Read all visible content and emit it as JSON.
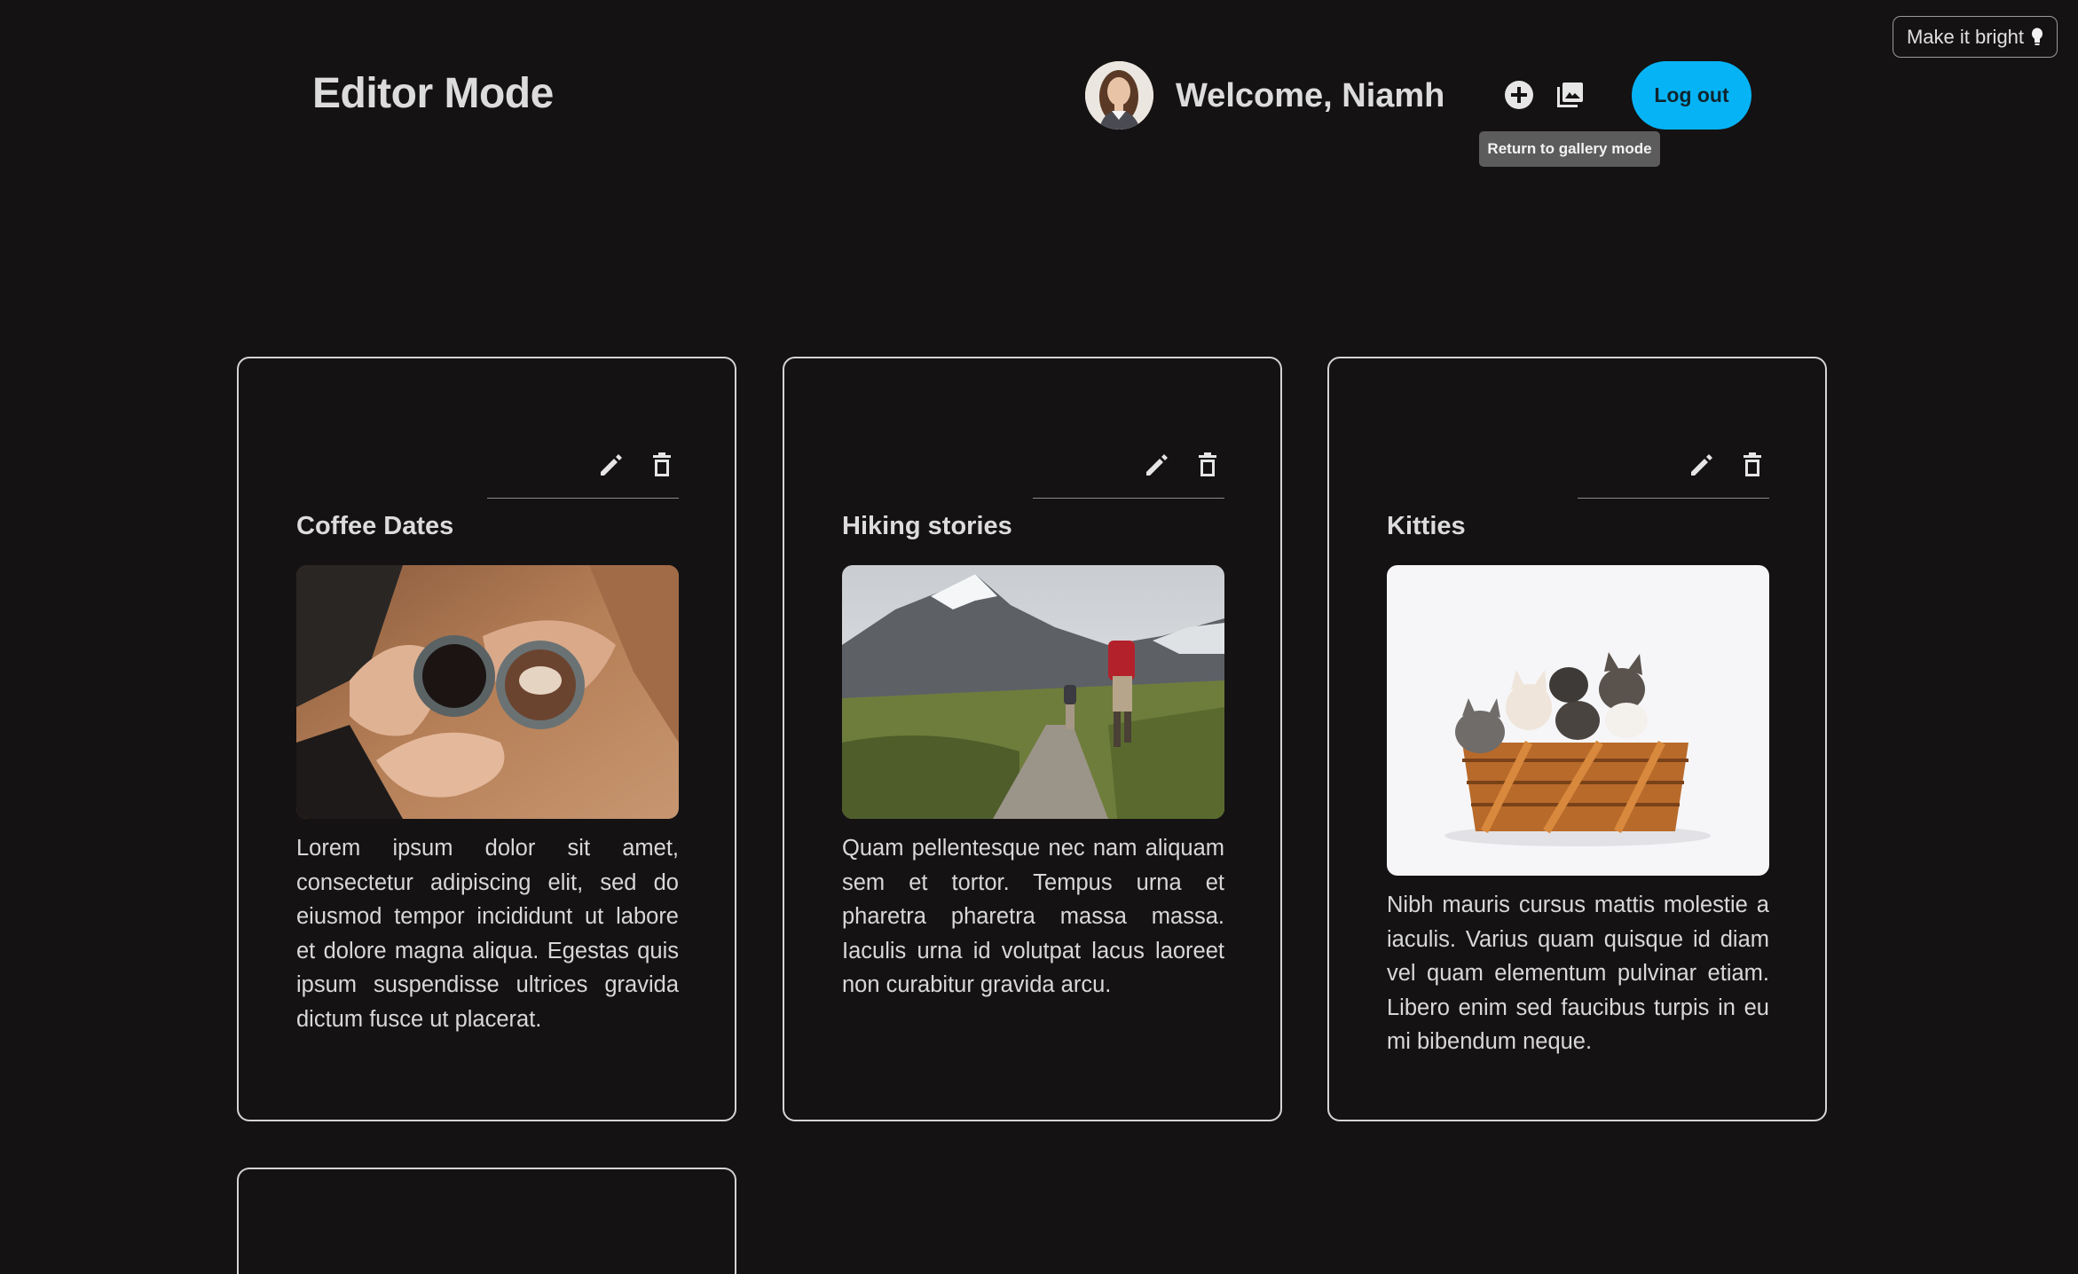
{
  "theme_toggle": {
    "label": "Make it bright"
  },
  "header": {
    "title": "Editor Mode",
    "welcome": "Welcome, Niamh",
    "logout_label": "Log out",
    "tooltip": "Return to gallery mode"
  },
  "cards": [
    {
      "title": "Coffee Dates",
      "text": "Lorem ipsum dolor sit amet, consectetur adipiscing elit, sed do eiusmod tempor incididunt ut labore et dolore magna aliqua. Egestas quis ipsum suspendisse ultrices gravida dictum fusce ut placerat."
    },
    {
      "title": "Hiking stories",
      "text": "Quam pellentesque nec nam aliquam sem et tortor. Tempus urna et pharetra pharetra massa massa. Iaculis urna id volutpat lacus laoreet non curabitur gravida arcu."
    },
    {
      "title": "Kitties",
      "text": "Nibh mauris cursus mattis molestie a iaculis. Varius quam quisque id diam vel quam elementum pulvinar etiam. Libero enim sed faucibus turpis in eu mi bibendum neque."
    }
  ],
  "colors": {
    "accent": "#06b4f6",
    "background": "#151213",
    "card_border": "#d4d4d4"
  }
}
